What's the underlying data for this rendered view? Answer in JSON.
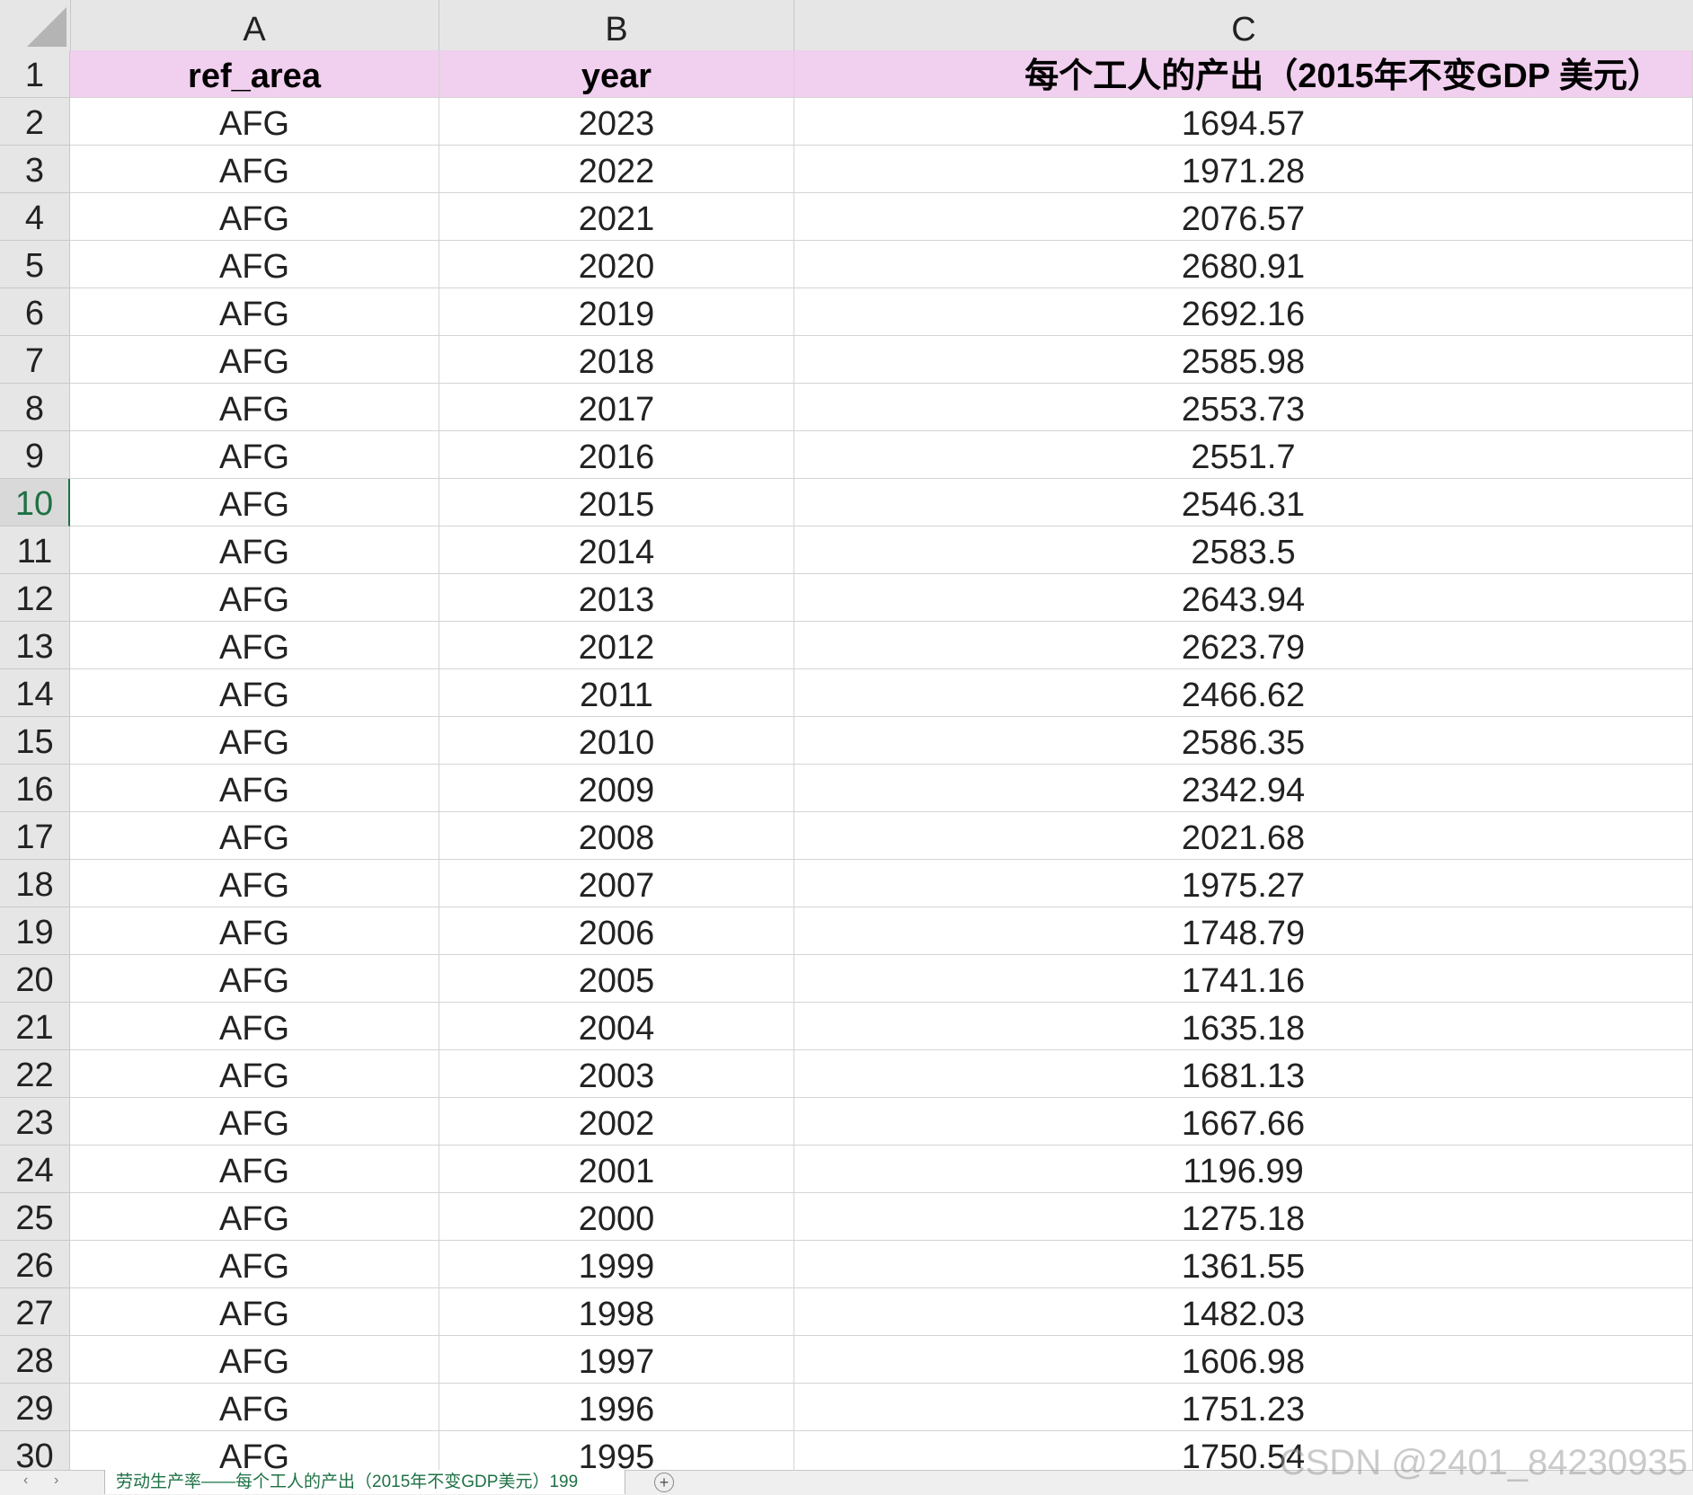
{
  "columns": [
    "A",
    "B",
    "C"
  ],
  "header_row": {
    "num": "1",
    "a": "ref_area",
    "b": "year",
    "c": "每个工人的产出（2015年不变GDP  美元）"
  },
  "rows": [
    {
      "num": "2",
      "a": "AFG",
      "b": "2023",
      "c": "1694.57"
    },
    {
      "num": "3",
      "a": "AFG",
      "b": "2022",
      "c": "1971.28"
    },
    {
      "num": "4",
      "a": "AFG",
      "b": "2021",
      "c": "2076.57"
    },
    {
      "num": "5",
      "a": "AFG",
      "b": "2020",
      "c": "2680.91"
    },
    {
      "num": "6",
      "a": "AFG",
      "b": "2019",
      "c": "2692.16"
    },
    {
      "num": "7",
      "a": "AFG",
      "b": "2018",
      "c": "2585.98"
    },
    {
      "num": "8",
      "a": "AFG",
      "b": "2017",
      "c": "2553.73"
    },
    {
      "num": "9",
      "a": "AFG",
      "b": "2016",
      "c": "2551.7"
    },
    {
      "num": "10",
      "a": "AFG",
      "b": "2015",
      "c": "2546.31"
    },
    {
      "num": "11",
      "a": "AFG",
      "b": "2014",
      "c": "2583.5"
    },
    {
      "num": "12",
      "a": "AFG",
      "b": "2013",
      "c": "2643.94"
    },
    {
      "num": "13",
      "a": "AFG",
      "b": "2012",
      "c": "2623.79"
    },
    {
      "num": "14",
      "a": "AFG",
      "b": "2011",
      "c": "2466.62"
    },
    {
      "num": "15",
      "a": "AFG",
      "b": "2010",
      "c": "2586.35"
    },
    {
      "num": "16",
      "a": "AFG",
      "b": "2009",
      "c": "2342.94"
    },
    {
      "num": "17",
      "a": "AFG",
      "b": "2008",
      "c": "2021.68"
    },
    {
      "num": "18",
      "a": "AFG",
      "b": "2007",
      "c": "1975.27"
    },
    {
      "num": "19",
      "a": "AFG",
      "b": "2006",
      "c": "1748.79"
    },
    {
      "num": "20",
      "a": "AFG",
      "b": "2005",
      "c": "1741.16"
    },
    {
      "num": "21",
      "a": "AFG",
      "b": "2004",
      "c": "1635.18"
    },
    {
      "num": "22",
      "a": "AFG",
      "b": "2003",
      "c": "1681.13"
    },
    {
      "num": "23",
      "a": "AFG",
      "b": "2002",
      "c": "1667.66"
    },
    {
      "num": "24",
      "a": "AFG",
      "b": "2001",
      "c": "1196.99"
    },
    {
      "num": "25",
      "a": "AFG",
      "b": "2000",
      "c": "1275.18"
    },
    {
      "num": "26",
      "a": "AFG",
      "b": "1999",
      "c": "1361.55"
    },
    {
      "num": "27",
      "a": "AFG",
      "b": "1998",
      "c": "1482.03"
    },
    {
      "num": "28",
      "a": "AFG",
      "b": "1997",
      "c": "1606.98"
    },
    {
      "num": "29",
      "a": "AFG",
      "b": "1996",
      "c": "1751.23"
    },
    {
      "num": "30",
      "a": "AFG",
      "b": "1995",
      "c": "1750.54"
    }
  ],
  "selected_row": "10",
  "sheet_tabs": {
    "active_label": "劳动生产率——每个工人的产出（2015年不变GDP美元）199"
  },
  "watermark": "CSDN @2401_84230935",
  "colors": {
    "header_fill": "#f1cfee",
    "active_tab_text": "#1e7145",
    "grid": "#d4d4d4",
    "header_bg": "#e6e6e6"
  }
}
